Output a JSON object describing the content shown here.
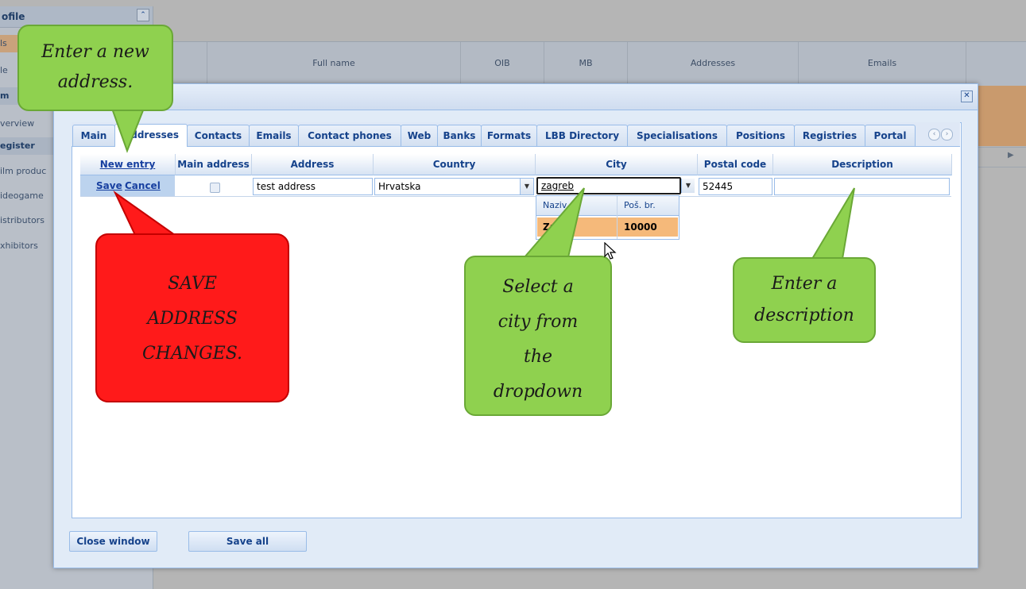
{
  "background": {
    "panel_title": "ofile",
    "side_items": [
      {
        "label": "ls",
        "style": "sel"
      },
      {
        "label": "le",
        "style": "plain"
      },
      {
        "label": "m",
        "style": "head"
      },
      {
        "label": "verview",
        "style": "plain"
      },
      {
        "label": "egister",
        "style": "head"
      },
      {
        "label": "ilm produc",
        "style": "plain"
      },
      {
        "label": "ideogame",
        "style": "plain"
      },
      {
        "label": "istributors",
        "style": "plain"
      },
      {
        "label": "xhibitors",
        "style": "plain"
      }
    ],
    "grid_columns": [
      "Full name",
      "OIB",
      "MB",
      "Addresses",
      "Emails"
    ]
  },
  "window": {
    "close_glyph": "✕",
    "tabs": [
      "Main",
      "Addresses",
      "Contacts",
      "Emails",
      "Contact phones",
      "Web",
      "Banks",
      "Formats",
      "LBB Directory",
      "Specialisations",
      "Positions",
      "Registries",
      "Portal"
    ],
    "active_tab": "Addresses",
    "grid": {
      "headers": {
        "new_entry": "New entry",
        "main_address": "Main address",
        "address": "Address",
        "country": "Country",
        "city": "City",
        "postal_code": "Postal code",
        "description": "Description"
      },
      "row": {
        "save": "Save",
        "cancel": "Cancel",
        "main_address_checked": false,
        "address": "test address",
        "country": "Hrvatska",
        "city": "zagreb",
        "postal_code": "52445",
        "description": ""
      }
    },
    "city_dropdown": {
      "col_name": "Naziv",
      "col_postal": "Poš. br.",
      "option_name": "Zagr",
      "option_postal": "10000"
    },
    "buttons": {
      "close_window": "Close window",
      "save_all": "Save all"
    }
  },
  "callouts": {
    "new_address": [
      "Enter a new",
      "address."
    ],
    "save_changes": [
      "SAVE",
      "ADDRESS",
      "CHANGES."
    ],
    "select_city": [
      "Select a",
      "city from",
      "the",
      "dropdown"
    ],
    "description": [
      "Enter a",
      "description"
    ]
  },
  "colors": {
    "callout_green": "#8fd14f",
    "callout_red": "#ff1a1a",
    "dropdown_highlight": "#f5b97a",
    "window_frame": "#99bce8"
  }
}
